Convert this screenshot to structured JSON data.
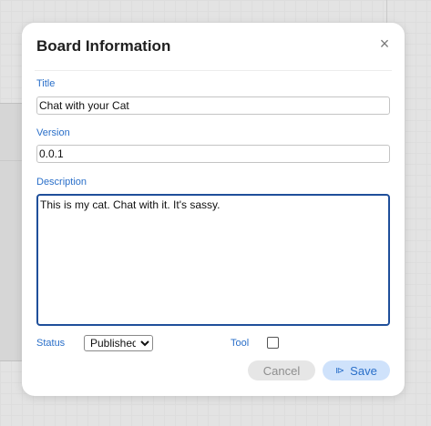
{
  "dialog": {
    "title": "Board Information",
    "close_glyph": "×",
    "title_label": "Title",
    "title_value": "Chat with your Cat",
    "version_label": "Version",
    "version_value": "0.0.1",
    "description_label": "Description",
    "description_value": "This is my cat. Chat with it. It's sassy.",
    "status_label": "Status",
    "status_value": "Published",
    "tool_label": "Tool",
    "tool_checked": false,
    "cancel_label": "Cancel",
    "save_label": "Save",
    "save_icon": "save-icon"
  },
  "colors": {
    "accent": "#2a6fc9",
    "save_bg": "#cfe2fb",
    "cancel_bg": "#e6e6e6",
    "focus_border": "#1f4f9a"
  }
}
